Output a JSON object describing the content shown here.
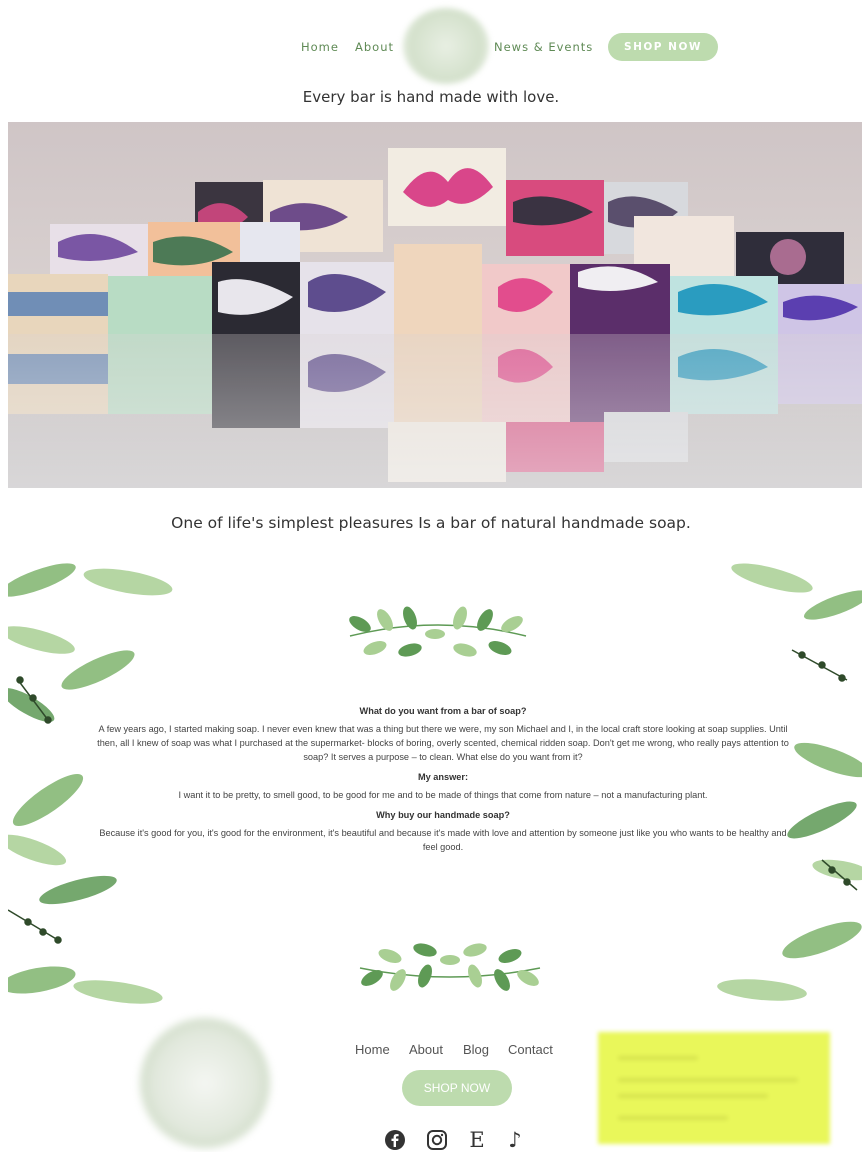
{
  "header": {
    "nav": [
      "Home",
      "About",
      "News & Events"
    ],
    "shop_button": "SHOP NOW"
  },
  "tagline": "Every bar is hand made with love.",
  "hero": {
    "alt": "Handmade soap bars arranged on a reflective surface"
  },
  "subtitle": "One of life's simplest pleasures Is a bar of natural handmade soap.",
  "story": {
    "q1": "What do you want from a bar of soap?",
    "p1": "A few years ago, I started making soap. I never even knew that was a thing but there we were, my son Michael and I, in the local craft store looking at soap supplies. Until then, all I knew of soap was what I purchased at the supermarket- blocks of boring, overly scented, chemical ridden soap. Don't get me wrong, who really pays attention to soap? It serves a purpose – to clean. What else do you want from it?",
    "q2": "My answer:",
    "p2": "I want it to be pretty, to smell good, to be good for me and to be made of things that come from nature – not a manufacturing plant.",
    "q3": "Why buy our handmade soap?",
    "p3": "Because it's good for you, it's good for the environment, it's beautiful and because it's made with love and attention by someone just like you who wants to be healthy and feel good."
  },
  "footer": {
    "nav": [
      "Home",
      "About",
      "Blog",
      "Contact"
    ],
    "shop_button": "SHOP NOW",
    "social": [
      "facebook-icon",
      "instagram-icon",
      "etsy-icon",
      "tiktok-icon"
    ],
    "etsy_glyph": "E",
    "tiktok_glyph": "♪"
  },
  "colors": {
    "accent_green": "#bddbae",
    "nav_green": "#5f8a55",
    "leaf_dark": "#5e9a55",
    "leaf_light": "#a9cf93"
  }
}
